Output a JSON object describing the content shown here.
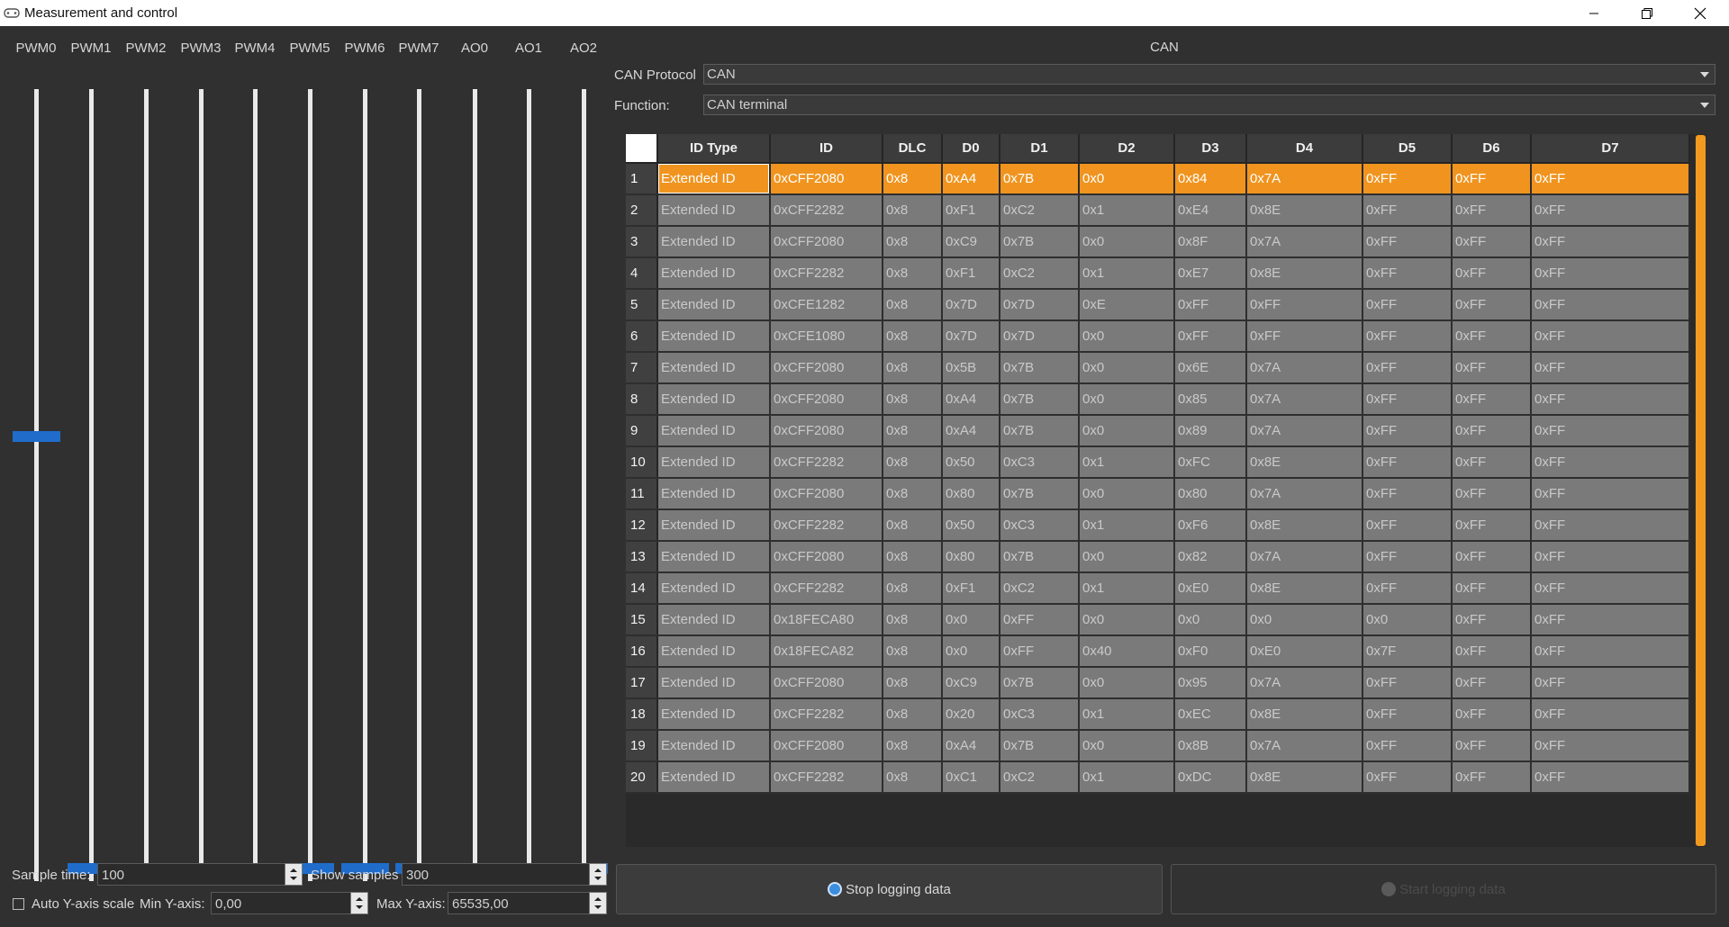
{
  "window": {
    "title": "Measurement and control"
  },
  "sliders": [
    {
      "label": "PWM0",
      "value": 0.56
    },
    {
      "label": "PWM1",
      "value": 0
    },
    {
      "label": "PWM2",
      "value": 0
    },
    {
      "label": "PWM3",
      "value": 0
    },
    {
      "label": "PWM4",
      "value": 0
    },
    {
      "label": "PWM5",
      "value": 0
    },
    {
      "label": "PWM6",
      "value": 0
    },
    {
      "label": "PWM7",
      "value": 0
    },
    {
      "label": "AO0",
      "value": 0
    },
    {
      "label": "AO1",
      "value": 0
    },
    {
      "label": "AO2",
      "value": 0
    }
  ],
  "controls": {
    "sample_time_label": "Sample time:",
    "sample_time_value": "100",
    "show_samples_label": "Show samples",
    "show_samples_value": "300",
    "auto_y_label": "Auto Y-axis scale",
    "auto_y_checked": false,
    "min_y_label": "Min Y-axis:",
    "min_y_value": "0,00",
    "max_y_label": "Max Y-axis:",
    "max_y_value": "65535,00"
  },
  "can": {
    "title": "CAN",
    "protocol_label": "CAN Protocol",
    "protocol_value": "CAN",
    "function_label": "Function:",
    "function_value": "CAN terminal",
    "headers": [
      "ID Type",
      "ID",
      "DLC",
      "D0",
      "D1",
      "D2",
      "D3",
      "D4",
      "D5",
      "D6",
      "D7"
    ],
    "selected_row": 1,
    "rows": [
      [
        "1",
        "Extended ID",
        "0xCFF2080",
        "0x8",
        "0xA4",
        "0x7B",
        "0x0",
        "0x84",
        "0x7A",
        "0xFF",
        "0xFF",
        "0xFF"
      ],
      [
        "2",
        "Extended ID",
        "0xCFF2282",
        "0x8",
        "0xF1",
        "0xC2",
        "0x1",
        "0xE4",
        "0x8E",
        "0xFF",
        "0xFF",
        "0xFF"
      ],
      [
        "3",
        "Extended ID",
        "0xCFF2080",
        "0x8",
        "0xC9",
        "0x7B",
        "0x0",
        "0x8F",
        "0x7A",
        "0xFF",
        "0xFF",
        "0xFF"
      ],
      [
        "4",
        "Extended ID",
        "0xCFF2282",
        "0x8",
        "0xF1",
        "0xC2",
        "0x1",
        "0xE7",
        "0x8E",
        "0xFF",
        "0xFF",
        "0xFF"
      ],
      [
        "5",
        "Extended ID",
        "0xCFE1282",
        "0x8",
        "0x7D",
        "0x7D",
        "0xE",
        "0xFF",
        "0xFF",
        "0xFF",
        "0xFF",
        "0xFF"
      ],
      [
        "6",
        "Extended ID",
        "0xCFE1080",
        "0x8",
        "0x7D",
        "0x7D",
        "0x0",
        "0xFF",
        "0xFF",
        "0xFF",
        "0xFF",
        "0xFF"
      ],
      [
        "7",
        "Extended ID",
        "0xCFF2080",
        "0x8",
        "0x5B",
        "0x7B",
        "0x0",
        "0x6E",
        "0x7A",
        "0xFF",
        "0xFF",
        "0xFF"
      ],
      [
        "8",
        "Extended ID",
        "0xCFF2080",
        "0x8",
        "0xA4",
        "0x7B",
        "0x0",
        "0x85",
        "0x7A",
        "0xFF",
        "0xFF",
        "0xFF"
      ],
      [
        "9",
        "Extended ID",
        "0xCFF2080",
        "0x8",
        "0xA4",
        "0x7B",
        "0x0",
        "0x89",
        "0x7A",
        "0xFF",
        "0xFF",
        "0xFF"
      ],
      [
        "10",
        "Extended ID",
        "0xCFF2282",
        "0x8",
        "0x50",
        "0xC3",
        "0x1",
        "0xFC",
        "0x8E",
        "0xFF",
        "0xFF",
        "0xFF"
      ],
      [
        "11",
        "Extended ID",
        "0xCFF2080",
        "0x8",
        "0x80",
        "0x7B",
        "0x0",
        "0x80",
        "0x7A",
        "0xFF",
        "0xFF",
        "0xFF"
      ],
      [
        "12",
        "Extended ID",
        "0xCFF2282",
        "0x8",
        "0x50",
        "0xC3",
        "0x1",
        "0xF6",
        "0x8E",
        "0xFF",
        "0xFF",
        "0xFF"
      ],
      [
        "13",
        "Extended ID",
        "0xCFF2080",
        "0x8",
        "0x80",
        "0x7B",
        "0x0",
        "0x82",
        "0x7A",
        "0xFF",
        "0xFF",
        "0xFF"
      ],
      [
        "14",
        "Extended ID",
        "0xCFF2282",
        "0x8",
        "0xF1",
        "0xC2",
        "0x1",
        "0xE0",
        "0x8E",
        "0xFF",
        "0xFF",
        "0xFF"
      ],
      [
        "15",
        "Extended ID",
        "0x18FECA80",
        "0x8",
        "0x0",
        "0xFF",
        "0x0",
        "0x0",
        "0x0",
        "0x0",
        "0xFF",
        "0xFF"
      ],
      [
        "16",
        "Extended ID",
        "0x18FECA82",
        "0x8",
        "0x0",
        "0xFF",
        "0x40",
        "0xF0",
        "0xE0",
        "0x7F",
        "0xFF",
        "0xFF"
      ],
      [
        "17",
        "Extended ID",
        "0xCFF2080",
        "0x8",
        "0xC9",
        "0x7B",
        "0x0",
        "0x95",
        "0x7A",
        "0xFF",
        "0xFF",
        "0xFF"
      ],
      [
        "18",
        "Extended ID",
        "0xCFF2282",
        "0x8",
        "0x20",
        "0xC3",
        "0x1",
        "0xEC",
        "0x8E",
        "0xFF",
        "0xFF",
        "0xFF"
      ],
      [
        "19",
        "Extended ID",
        "0xCFF2080",
        "0x8",
        "0xA4",
        "0x7B",
        "0x0",
        "0x8B",
        "0x7A",
        "0xFF",
        "0xFF",
        "0xFF"
      ],
      [
        "20",
        "Extended ID",
        "0xCFF2282",
        "0x8",
        "0xC1",
        "0xC2",
        "0x1",
        "0xDC",
        "0x8E",
        "0xFF",
        "0xFF",
        "0xFF"
      ]
    ]
  },
  "buttons": {
    "stop_logging": "Stop logging data",
    "start_logging": "Start logging data"
  },
  "colors": {
    "accent": "#f0941f",
    "slider_handle": "#1f6ccb",
    "stop_icon": "#3b8de0"
  }
}
